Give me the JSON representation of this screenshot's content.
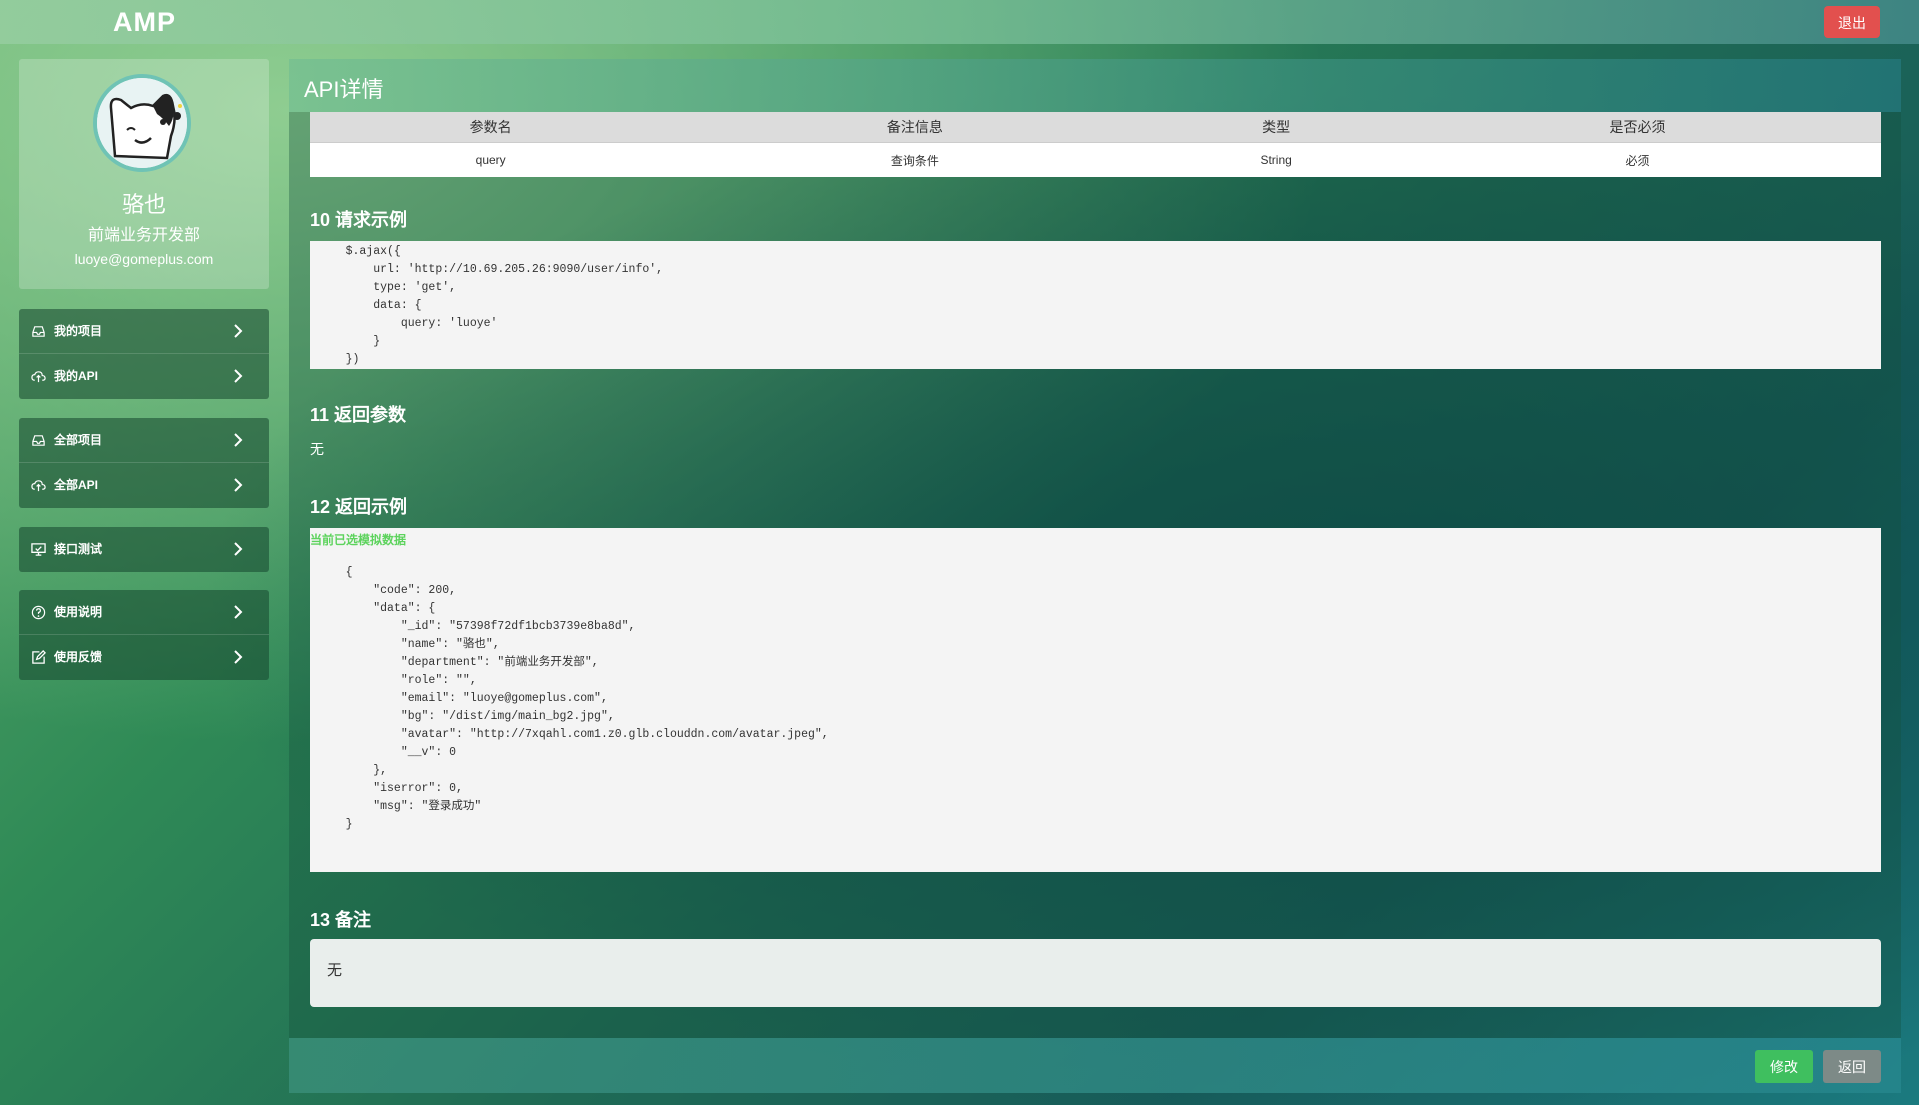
{
  "header": {
    "logo": "AMP",
    "logout_label": "退出"
  },
  "profile": {
    "name": "骆也",
    "department": "前端业务开发部",
    "email": "luoye@gomeplus.com"
  },
  "nav_groups": [
    [
      {
        "label": "我的项目",
        "icon": "inbox-icon"
      },
      {
        "label": "我的API",
        "icon": "cloud-icon"
      }
    ],
    [
      {
        "label": "全部项目",
        "icon": "inbox-icon"
      },
      {
        "label": "全部API",
        "icon": "cloud-icon"
      }
    ],
    [
      {
        "label": "接口测试",
        "icon": "monitor-icon"
      }
    ],
    [
      {
        "label": "使用说明",
        "icon": "question-icon"
      },
      {
        "label": "使用反馈",
        "icon": "edit-icon"
      }
    ]
  ],
  "panel": {
    "title": "API详情"
  },
  "params_table": {
    "headers": [
      "参数名",
      "备注信息",
      "类型",
      "是否必须"
    ],
    "rows": [
      [
        "query",
        "查询条件",
        "String",
        "必须"
      ]
    ]
  },
  "request_example": {
    "title": "10 请求示例",
    "code": "    $.ajax({\n        url: 'http://10.69.205.26:9090/user/info',\n        type: 'get',\n        data: {\n            query: 'luoye'\n        }\n    })"
  },
  "return_params": {
    "title": "11 返回参数",
    "value": "无"
  },
  "return_example": {
    "title": "12 返回示例",
    "hint": "当前已选模拟数据",
    "code": "    {\n        \"code\": 200,\n        \"data\": {\n            \"_id\": \"57398f72df1bcb3739e8ba8d\",\n            \"name\": \"骆也\",\n            \"department\": \"前端业务开发部\",\n            \"role\": \"\",\n            \"email\": \"luoye@gomeplus.com\",\n            \"bg\": \"/dist/img/main_bg2.jpg\",\n            \"avatar\": \"http://7xqahl.com1.z0.glb.clouddn.com/avatar.jpeg\",\n            \"__v\": 0\n        },\n        \"iserror\": 0,\n        \"msg\": \"登录成功\"\n    }"
  },
  "remark": {
    "title": "13 备注",
    "value": "无"
  },
  "footer": {
    "edit_label": "修改",
    "back_label": "返回"
  },
  "colors": {
    "logout": "#e2504e",
    "edit": "#3fbf5f",
    "back": "#7d8a87",
    "mock_hint": "#5dd35d"
  }
}
